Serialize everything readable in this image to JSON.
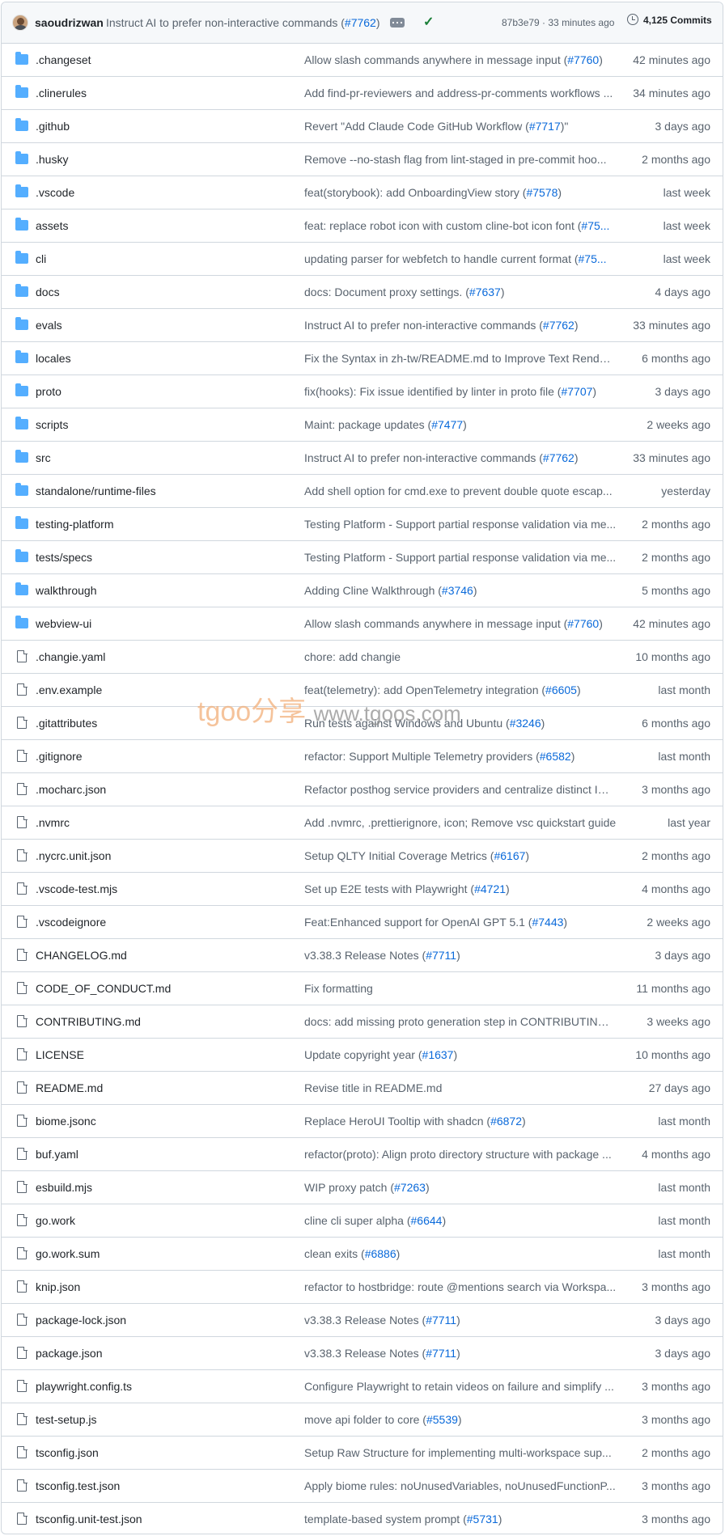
{
  "header": {
    "author": "saoudrizwan",
    "commit_message": "Instruct AI to prefer non-interactive commands (",
    "commit_pr": "#7762",
    "commit_pr_close": ")",
    "sha_time": "87b3e79 · 33 minutes ago",
    "commits_count": "4,125 Commits",
    "status": "success"
  },
  "watermark": {
    "brand": "tgoo分享",
    "url": "www.tgoos.com"
  },
  "colors": {
    "folder": "#54aeff",
    "link": "#0969da",
    "check": "#1a7f37",
    "border": "#d0d7de",
    "header_bg": "#f6f8fa"
  },
  "files": [
    {
      "type": "folder",
      "name": ".changeset",
      "msg": "Allow slash commands anywhere in message input (",
      "pr": "#7760",
      "close": ")",
      "age": "42 minutes ago"
    },
    {
      "type": "folder",
      "name": ".clinerules",
      "msg": "Add find-pr-reviewers and address-pr-comments workflows ...",
      "pr": "",
      "close": "",
      "age": "34 minutes ago"
    },
    {
      "type": "folder",
      "name": ".github",
      "msg": "Revert \"Add Claude Code GitHub Workflow (",
      "pr": "#7717",
      "close": ")\"",
      "age": "3 days ago"
    },
    {
      "type": "folder",
      "name": ".husky",
      "msg": "Remove --no-stash flag from lint-staged in pre-commit hoo...",
      "pr": "",
      "close": "",
      "age": "2 months ago"
    },
    {
      "type": "folder",
      "name": ".vscode",
      "msg": "feat(storybook): add OnboardingView story (",
      "pr": "#7578",
      "close": ")",
      "age": "last week"
    },
    {
      "type": "folder",
      "name": "assets",
      "msg": "feat: replace robot icon with custom cline-bot icon font (",
      "pr": "#75...",
      "close": "",
      "age": "last week"
    },
    {
      "type": "folder",
      "name": "cli",
      "msg": "updating parser for webfetch to handle current format (",
      "pr": "#75...",
      "close": "",
      "age": "last week"
    },
    {
      "type": "folder",
      "name": "docs",
      "msg": "docs: Document proxy settings. (",
      "pr": "#7637",
      "close": ")",
      "age": "4 days ago"
    },
    {
      "type": "folder",
      "name": "evals",
      "msg": "Instruct AI to prefer non-interactive commands (",
      "pr": "#7762",
      "close": ")",
      "age": "33 minutes ago"
    },
    {
      "type": "folder",
      "name": "locales",
      "msg": "Fix the Syntax in zh-tw/README.md to Improve Text Renderi...",
      "pr": "",
      "close": "",
      "age": "6 months ago"
    },
    {
      "type": "folder",
      "name": "proto",
      "msg": "fix(hooks): Fix issue identified by linter in proto file (",
      "pr": "#7707",
      "close": ")",
      "age": "3 days ago"
    },
    {
      "type": "folder",
      "name": "scripts",
      "msg": "Maint: package updates (",
      "pr": "#7477",
      "close": ")",
      "age": "2 weeks ago"
    },
    {
      "type": "folder",
      "name": "src",
      "msg": "Instruct AI to prefer non-interactive commands (",
      "pr": "#7762",
      "close": ")",
      "age": "33 minutes ago"
    },
    {
      "type": "folder",
      "name": "standalone/runtime-files",
      "msg": "Add shell option for cmd.exe to prevent double quote escap...",
      "pr": "",
      "close": "",
      "age": "yesterday"
    },
    {
      "type": "folder",
      "name": "testing-platform",
      "msg": "Testing Platform - Support partial response validation via me...",
      "pr": "",
      "close": "",
      "age": "2 months ago"
    },
    {
      "type": "folder",
      "name": "tests/specs",
      "msg": "Testing Platform - Support partial response validation via me...",
      "pr": "",
      "close": "",
      "age": "2 months ago"
    },
    {
      "type": "folder",
      "name": "walkthrough",
      "msg": "Adding Cline Walkthrough (",
      "pr": "#3746",
      "close": ")",
      "age": "5 months ago"
    },
    {
      "type": "folder",
      "name": "webview-ui",
      "msg": "Allow slash commands anywhere in message input (",
      "pr": "#7760",
      "close": ")",
      "age": "42 minutes ago"
    },
    {
      "type": "file",
      "name": ".changie.yaml",
      "msg": "chore: add changie",
      "pr": "",
      "close": "",
      "age": "10 months ago"
    },
    {
      "type": "file",
      "name": ".env.example",
      "msg": "feat(telemetry): add OpenTelemetry integration (",
      "pr": "#6605",
      "close": ")",
      "age": "last month"
    },
    {
      "type": "file",
      "name": ".gitattributes",
      "msg": "Run tests against Windows and Ubuntu (",
      "pr": "#3246",
      "close": ")",
      "age": "6 months ago"
    },
    {
      "type": "file",
      "name": ".gitignore",
      "msg": "refactor: Support Multiple Telemetry providers (",
      "pr": "#6582",
      "close": ")",
      "age": "last month"
    },
    {
      "type": "file",
      "name": ".mocharc.json",
      "msg": "Refactor posthog service providers and centralize distinct ID ...",
      "pr": "",
      "close": "",
      "age": "3 months ago"
    },
    {
      "type": "file",
      "name": ".nvmrc",
      "msg": "Add .nvmrc, .prettierignore, icon; Remove vsc quickstart guide",
      "pr": "",
      "close": "",
      "age": "last year"
    },
    {
      "type": "file",
      "name": ".nycrc.unit.json",
      "msg": "Setup QLTY Initial Coverage Metrics (",
      "pr": "#6167",
      "close": ")",
      "age": "2 months ago"
    },
    {
      "type": "file",
      "name": ".vscode-test.mjs",
      "msg": "Set up E2E tests with Playwright (",
      "pr": "#4721",
      "close": ")",
      "age": "4 months ago"
    },
    {
      "type": "file",
      "name": ".vscodeignore",
      "msg": "Feat:Enhanced support for OpenAI GPT 5.1 (",
      "pr": "#7443",
      "close": ")",
      "age": "2 weeks ago"
    },
    {
      "type": "file",
      "name": "CHANGELOG.md",
      "msg": "v3.38.3 Release Notes (",
      "pr": "#7711",
      "close": ")",
      "age": "3 days ago"
    },
    {
      "type": "file",
      "name": "CODE_OF_CONDUCT.md",
      "msg": "Fix formatting",
      "pr": "",
      "close": "",
      "age": "11 months ago"
    },
    {
      "type": "file",
      "name": "CONTRIBUTING.md",
      "msg": "docs: add missing proto generation step in CONTRIBUTING....",
      "pr": "",
      "close": "",
      "age": "3 weeks ago"
    },
    {
      "type": "file",
      "name": "LICENSE",
      "msg": "Update copyright year (",
      "pr": "#1637",
      "close": ")",
      "age": "10 months ago"
    },
    {
      "type": "file",
      "name": "README.md",
      "msg": "Revise title in README.md",
      "pr": "",
      "close": "",
      "age": "27 days ago"
    },
    {
      "type": "file",
      "name": "biome.jsonc",
      "msg": "Replace HeroUI Tooltip with shadcn (",
      "pr": "#6872",
      "close": ")",
      "age": "last month"
    },
    {
      "type": "file",
      "name": "buf.yaml",
      "msg": "refactor(proto): Align proto directory structure with package ...",
      "pr": "",
      "close": "",
      "age": "4 months ago"
    },
    {
      "type": "file",
      "name": "esbuild.mjs",
      "msg": "WIP proxy patch (",
      "pr": "#7263",
      "close": ")",
      "age": "last month"
    },
    {
      "type": "file",
      "name": "go.work",
      "msg": "cline cli super alpha (",
      "pr": "#6644",
      "close": ")",
      "age": "last month"
    },
    {
      "type": "file",
      "name": "go.work.sum",
      "msg": "clean exits (",
      "pr": "#6886",
      "close": ")",
      "age": "last month"
    },
    {
      "type": "file",
      "name": "knip.json",
      "msg": "refactor to hostbridge: route @mentions search via Workspa...",
      "pr": "",
      "close": "",
      "age": "3 months ago"
    },
    {
      "type": "file",
      "name": "package-lock.json",
      "msg": "v3.38.3 Release Notes (",
      "pr": "#7711",
      "close": ")",
      "age": "3 days ago"
    },
    {
      "type": "file",
      "name": "package.json",
      "msg": "v3.38.3 Release Notes (",
      "pr": "#7711",
      "close": ")",
      "age": "3 days ago"
    },
    {
      "type": "file",
      "name": "playwright.config.ts",
      "msg": "Configure Playwright to retain videos on failure and simplify ...",
      "pr": "",
      "close": "",
      "age": "3 months ago"
    },
    {
      "type": "file",
      "name": "test-setup.js",
      "msg": "move api folder to core (",
      "pr": "#5539",
      "close": ")",
      "age": "3 months ago"
    },
    {
      "type": "file",
      "name": "tsconfig.json",
      "msg": "Setup Raw Structure for implementing multi-workspace sup...",
      "pr": "",
      "close": "",
      "age": "2 months ago"
    },
    {
      "type": "file",
      "name": "tsconfig.test.json",
      "msg": "Apply biome rules: noUnusedVariables, noUnusedFunctionP...",
      "pr": "",
      "close": "",
      "age": "3 months ago"
    },
    {
      "type": "file",
      "name": "tsconfig.unit-test.json",
      "msg": "template-based system prompt (",
      "pr": "#5731",
      "close": ")",
      "age": "3 months ago"
    }
  ]
}
